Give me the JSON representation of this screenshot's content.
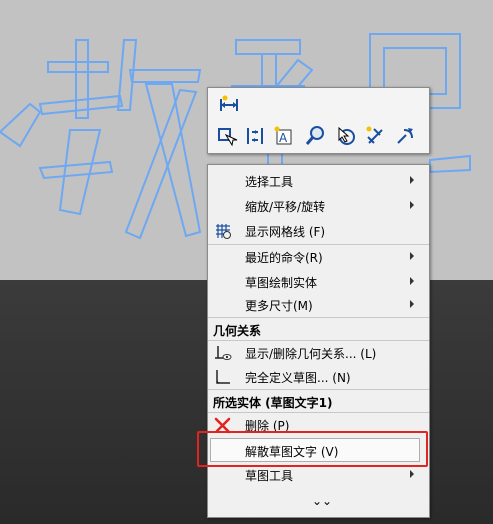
{
  "sketch_text": "教程",
  "toolbar": {
    "row1": [
      "smart-dimension-icon"
    ],
    "row2": [
      "move-entities-icon",
      "relation-icon",
      "sketch-text-icon",
      "zoom-icon",
      "select-icon",
      "dimension-icon",
      "rotate-icon"
    ]
  },
  "menu": {
    "items_top": [
      {
        "label": "选择工具",
        "submenu": true
      },
      {
        "label": "缩放/平移/旋转",
        "submenu": true
      },
      {
        "label": "显示网格线 (F)",
        "submenu": false
      },
      {
        "label": "最近的命令(R)",
        "submenu": true
      },
      {
        "label": "草图绘制实体",
        "submenu": true
      },
      {
        "label": "更多尺寸(M)",
        "submenu": true
      }
    ],
    "section_relations": "几何关系",
    "items_relations": [
      {
        "label": "显示/删除几何关系... (L)"
      },
      {
        "label": "完全定义草图... (N)"
      }
    ],
    "section_selected": "所选实体 (草图文字1)",
    "item_delete": "删除 (P)",
    "item_explode": "解散草图文字 (V)",
    "item_sketch_tools": "草图工具",
    "more": "»"
  },
  "colors": {
    "highlight": "#e0241f",
    "sketch_line": "#6ea8f2"
  }
}
